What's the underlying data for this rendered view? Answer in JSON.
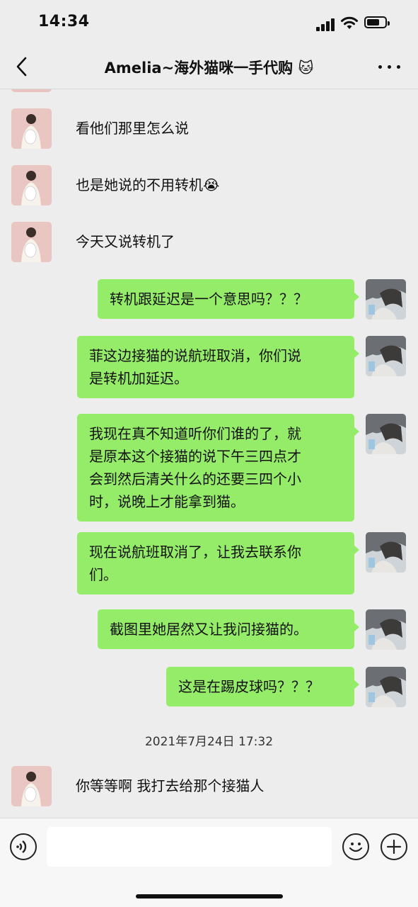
{
  "status_bar": {
    "time": "14:34"
  },
  "header": {
    "title": "Amelia~海外猫咪一手代购 🐱"
  },
  "messages": [
    {
      "side": "in",
      "text": "看他们那里怎么说"
    },
    {
      "side": "in",
      "text": "也是她说的不用转机😭"
    },
    {
      "side": "in",
      "text": "今天又说转机了"
    },
    {
      "side": "out",
      "lines": [
        "转机跟延迟是一个意思吗？？？"
      ]
    },
    {
      "side": "out",
      "lines": [
        "菲这边接猫的说航班取消，你们说",
        "是转机加延迟。"
      ]
    },
    {
      "side": "out",
      "lines": [
        "我现在真不知道听你们谁的了，就",
        "是原本这个接猫的说下午三四点才",
        "会到然后清关什么的还要三四个小",
        "时，说晚上才能拿到猫。"
      ]
    },
    {
      "side": "out",
      "lines": [
        "现在说航班取消了，让我去联系你",
        "们。"
      ]
    },
    {
      "side": "out",
      "lines": [
        "截图里她居然又让我问接猫的。"
      ]
    },
    {
      "side": "out",
      "lines": [
        "这是在踢皮球吗？？？"
      ]
    },
    {
      "side": "in",
      "text": "你等等啊 我打去给那个接猫人"
    }
  ],
  "timestamp": "2021年7月24日 17:32",
  "input": {
    "value": ""
  },
  "icons": {
    "back": "chevron-left-icon",
    "more": "more-dots-icon",
    "voice": "voice-icon",
    "emoji": "emoji-icon",
    "plus": "plus-icon"
  },
  "colors": {
    "outgoing_bubble": "#95ec69",
    "background": "#ededed"
  }
}
